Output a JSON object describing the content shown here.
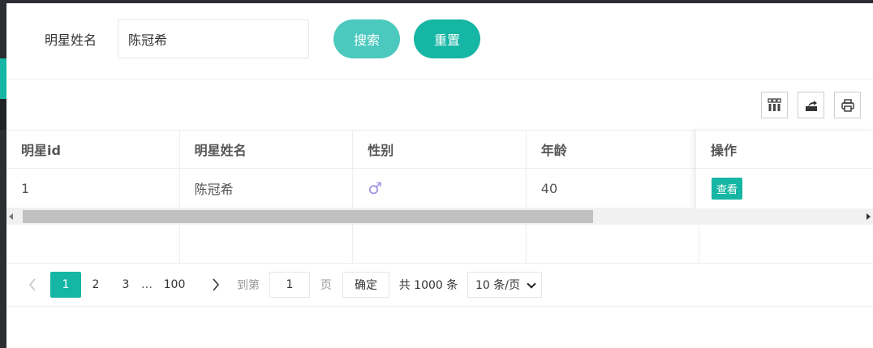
{
  "search": {
    "label": "明星姓名",
    "value": "陈冠希",
    "search_button": "搜索",
    "reset_button": "重置"
  },
  "toolbar": {
    "icons": [
      "columns-icon",
      "export-icon",
      "print-icon"
    ]
  },
  "table": {
    "headers": [
      "明星id",
      "明星姓名",
      "性别",
      "年龄",
      "操作"
    ],
    "rows": [
      {
        "id": "1",
        "name": "陈冠希",
        "gender": "♂",
        "age": "40",
        "action": "查看"
      }
    ]
  },
  "pagination": {
    "pages": [
      "1",
      "2",
      "3",
      "…",
      "100"
    ],
    "current": "1",
    "goto_label": "到第",
    "goto_value": "1",
    "page_unit": "页",
    "confirm": "确定",
    "total": "共 1000 条",
    "page_size": "10 条/页"
  },
  "colors": {
    "accent": "#16b6a4",
    "accent_light": "#4cc9be",
    "male_icon": "#9b93e0"
  }
}
